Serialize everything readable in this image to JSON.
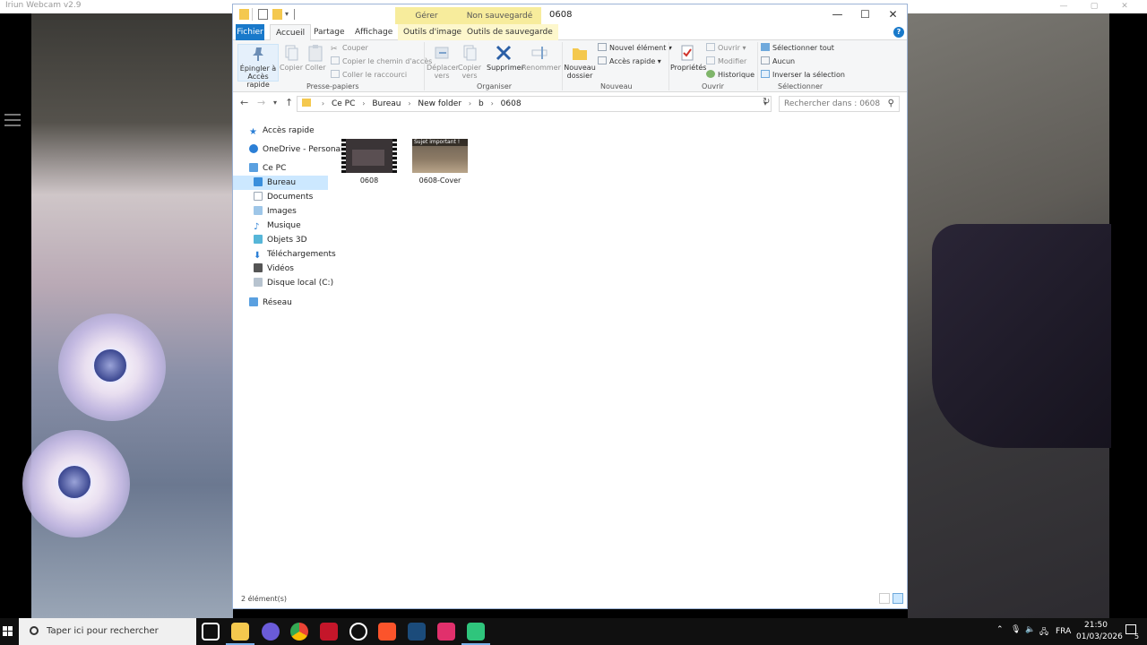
{
  "background_app": {
    "title": "Iriun Webcam v2.9"
  },
  "explorer": {
    "window_title": "0608",
    "context_tabs": {
      "gerer": "Gérer",
      "non_sauvegarde": "Non sauvegardé"
    },
    "tabs": {
      "fichier": "Fichier",
      "accueil": "Accueil",
      "partage": "Partage",
      "affichage": "Affichage",
      "outils_image": "Outils d'image",
      "outils_sauvegarde": "Outils de sauvegarde"
    },
    "ribbon": {
      "presse_papiers": {
        "label": "Presse-papiers",
        "epingler_line1": "Épingler à",
        "epingler_line2": "Accès rapide",
        "copier": "Copier",
        "coller": "Coller",
        "couper": "Couper",
        "copier_chemin": "Copier le chemin d'accès",
        "coller_raccourci": "Coller le raccourci"
      },
      "organiser": {
        "label": "Organiser",
        "deplacer_line1": "Déplacer",
        "deplacer_line2": "vers",
        "copier_line1": "Copier",
        "copier_line2": "vers",
        "supprimer": "Supprimer",
        "renommer": "Renommer"
      },
      "nouveau": {
        "label": "Nouveau",
        "nouveau_dossier_line1": "Nouveau",
        "nouveau_dossier_line2": "dossier",
        "nouvel_element": "Nouvel élément",
        "acces_rapide": "Accès rapide"
      },
      "ouvrir": {
        "label": "Ouvrir",
        "proprietes": "Propriétés",
        "ouvrir": "Ouvrir",
        "modifier": "Modifier",
        "historique": "Historique"
      },
      "selectionner": {
        "label": "Sélectionner",
        "tout": "Sélectionner tout",
        "aucun": "Aucun",
        "inverser": "Inverser la sélection"
      }
    },
    "address": {
      "crumbs": [
        "Ce PC",
        "Bureau",
        "New folder",
        "b",
        "0608"
      ],
      "search_placeholder": "Rechercher dans : 0608"
    },
    "nav": {
      "acces_rapide": "Accès rapide",
      "onedrive": "OneDrive - Personal",
      "ce_pc": "Ce PC",
      "bureau": "Bureau",
      "documents": "Documents",
      "images": "Images",
      "musique": "Musique",
      "objets3d": "Objets 3D",
      "telechargements": "Téléchargements",
      "videos": "Vidéos",
      "disque": "Disque local (C:)",
      "reseau": "Réseau"
    },
    "files": [
      {
        "name": "0608"
      },
      {
        "name": "0608-Cover",
        "thumb_text": "Sujet important !"
      }
    ],
    "status": "2 élément(s)"
  },
  "taskbar": {
    "search_placeholder": "Taper ici pour rechercher",
    "language": "FRA",
    "time": "21:50",
    "date": "01/03/2026",
    "notification_count": "5"
  },
  "colors": {
    "accent": "#1979ca",
    "context_tab": "#f7ec9c",
    "selected_nav": "#cce8ff"
  }
}
